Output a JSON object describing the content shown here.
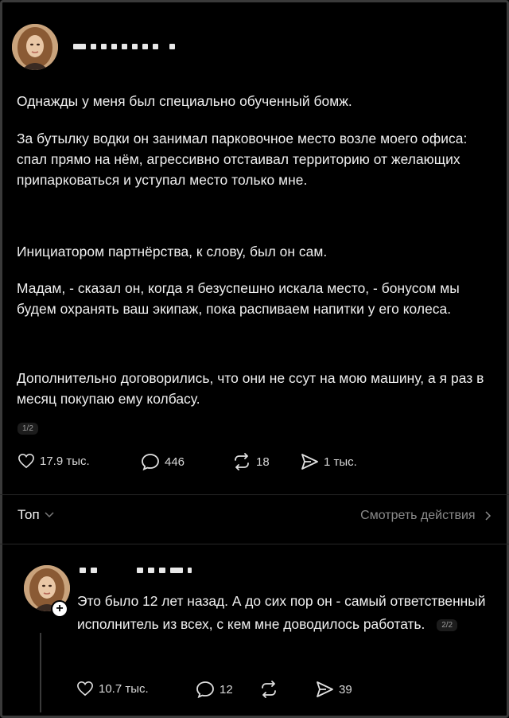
{
  "post": {
    "paragraphs": [
      "Однажды у меня был специально обученный бомж.",
      "За бутылку водки он занимал парковочное место возле моего офиса: спал прямо на нём, агрессивно отстаивал территорию от желающих припарковаться и уступал место только мне.",
      "Инициатором партнёрства, к слову, был он сам.",
      "Мадам, - сказал он, когда я безуспешно искала место, - бонусом мы будем охранять ваш экипаж, пока распиваем напитки у его колеса.",
      "Дополнительно договорились, что они не ссут на мою машину, а я раз в месяц покупаю ему колбасу."
    ],
    "page_indicator": "1/2",
    "likes": "17.9 тыс.",
    "replies": "446",
    "reposts": "18",
    "shares": "1 тыс."
  },
  "filter": {
    "label": "Топ",
    "view_activity": "Смотреть действия"
  },
  "comment": {
    "text": "Это было 12 лет назад. А до сих пор он - самый ответственный исполнитель из всех, с кем мне доводилось работать.",
    "page_indicator": "2/2",
    "likes": "10.7 тыс.",
    "replies": "12",
    "reposts": "",
    "shares": "39"
  },
  "icons": {
    "like": "heart-icon",
    "reply": "speech-bubble-icon",
    "repost": "repost-arrows-icon",
    "share": "send-icon",
    "chevron_down": "chevron-down-icon",
    "chevron_right": "chevron-right-icon",
    "follow": "plus-icon"
  },
  "colors": {
    "background": "#000000",
    "text": "#f0f0f0",
    "muted": "#8a8a8a"
  }
}
